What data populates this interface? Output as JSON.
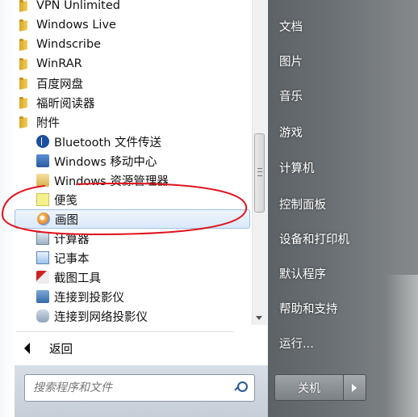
{
  "programs": [
    {
      "label": "VPN Unlimited",
      "icon": "folder-icon"
    },
    {
      "label": "Windows Live",
      "icon": "folder-icon"
    },
    {
      "label": "Windscribe",
      "icon": "folder-icon"
    },
    {
      "label": "WinRAR",
      "icon": "folder-icon"
    },
    {
      "label": "百度网盘",
      "icon": "folder-icon"
    },
    {
      "label": "福昕阅读器",
      "icon": "folder-icon"
    },
    {
      "label": "附件",
      "icon": "folder-icon"
    },
    {
      "label": "Bluetooth 文件传送",
      "icon": "bluetooth-icon"
    },
    {
      "label": "Windows 移动中心",
      "icon": "mobility-center-icon"
    },
    {
      "label": "Windows 资源管理器",
      "icon": "explorer-icon"
    },
    {
      "label": "便笺",
      "icon": "sticky-notes-icon"
    },
    {
      "label": "画图",
      "icon": "paint-icon"
    },
    {
      "label": "计算器",
      "icon": "calculator-icon"
    },
    {
      "label": "记事本",
      "icon": "notepad-icon"
    },
    {
      "label": "截图工具",
      "icon": "snipping-tool-icon"
    },
    {
      "label": "连接到投影仪",
      "icon": "projector-icon"
    },
    {
      "label": "连接到网络投影仪",
      "icon": "network-projector-icon"
    }
  ],
  "back_label": "返回",
  "search": {
    "placeholder": "搜索程序和文件"
  },
  "right_menu": [
    "文档",
    "图片",
    "音乐",
    "游戏",
    "计算机",
    "控制面板",
    "设备和打印机",
    "默认程序",
    "帮助和支持",
    "运行..."
  ],
  "shutdown_label": "关机",
  "colors": {
    "annotation": "#e0141e",
    "selection": "#dbe9f9",
    "right_pane": "#6c7175"
  }
}
